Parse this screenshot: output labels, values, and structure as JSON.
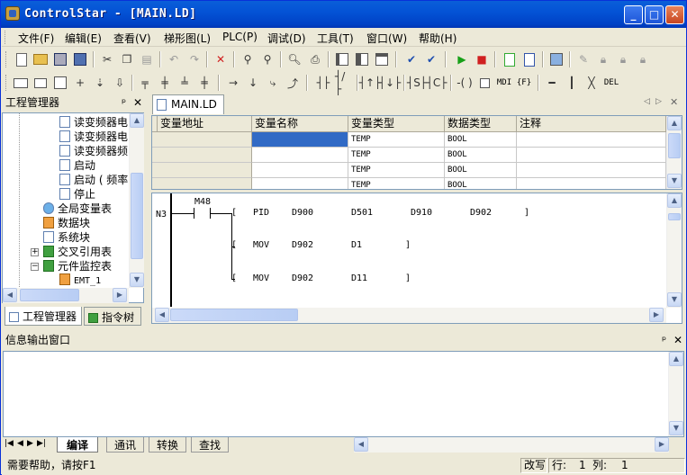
{
  "window": {
    "title": "ControlStar - [MAIN.LD]",
    "minimize": "_",
    "maximize": "□",
    "close": "✕"
  },
  "menu": [
    "文件(F)",
    "编辑(E)",
    "查看(V)",
    "梯形图(L)",
    "PLC(P)",
    "调试(D)",
    "工具(T)",
    "窗口(W)",
    "帮助(H)"
  ],
  "toolbar2": {
    "mdi": "MDI",
    "f": "{F}",
    "del": "DEL"
  },
  "left_panel": {
    "title": "工程管理器",
    "pin": "ᵖ",
    "close": "✕",
    "tree": [
      {
        "label": "读变频器电"
      },
      {
        "label": "读变频器电"
      },
      {
        "label": "读变频器频"
      },
      {
        "label": "启动"
      },
      {
        "label": "启动 ( 频率"
      },
      {
        "label": "停止"
      },
      {
        "label": "全局变量表"
      },
      {
        "label": "数据块"
      },
      {
        "label": "系统块"
      },
      {
        "label": "交叉引用表"
      },
      {
        "label": "元件监控表"
      },
      {
        "label": "EMT_1"
      }
    ],
    "tabs": [
      "工程管理器",
      "指令树"
    ]
  },
  "document": {
    "tab": "MAIN.LD",
    "var_table": {
      "headers": [
        "变量地址",
        "变量名称",
        "变量类型",
        "数据类型",
        "注释"
      ],
      "rows": [
        [
          "",
          "",
          "TEMP",
          "BOOL",
          ""
        ],
        [
          "",
          "",
          "TEMP",
          "BOOL",
          ""
        ],
        [
          "",
          "",
          "TEMP",
          "BOOL",
          ""
        ],
        [
          "",
          "",
          "TEMP",
          "BOOL",
          ""
        ]
      ]
    },
    "ladder": {
      "network": "N3",
      "contact": "M48",
      "instructions": [
        {
          "op": "PID",
          "args": [
            "D900",
            "D501",
            "D910",
            "D902"
          ]
        },
        {
          "op": "MOV",
          "args": [
            "D902",
            "D1"
          ]
        },
        {
          "op": "MOV",
          "args": [
            "D902",
            "D11"
          ]
        }
      ]
    }
  },
  "output_panel": {
    "title": "信息输出窗口",
    "pin": "ᵖ",
    "close": "✕",
    "tabs": [
      "编译",
      "通讯",
      "转换",
      "查找"
    ]
  },
  "status_bar": {
    "help": "需要帮助，请按F1",
    "mode": "改写",
    "row_label": "行:",
    "row": "1",
    "col_label": "列:",
    "col": "1"
  }
}
